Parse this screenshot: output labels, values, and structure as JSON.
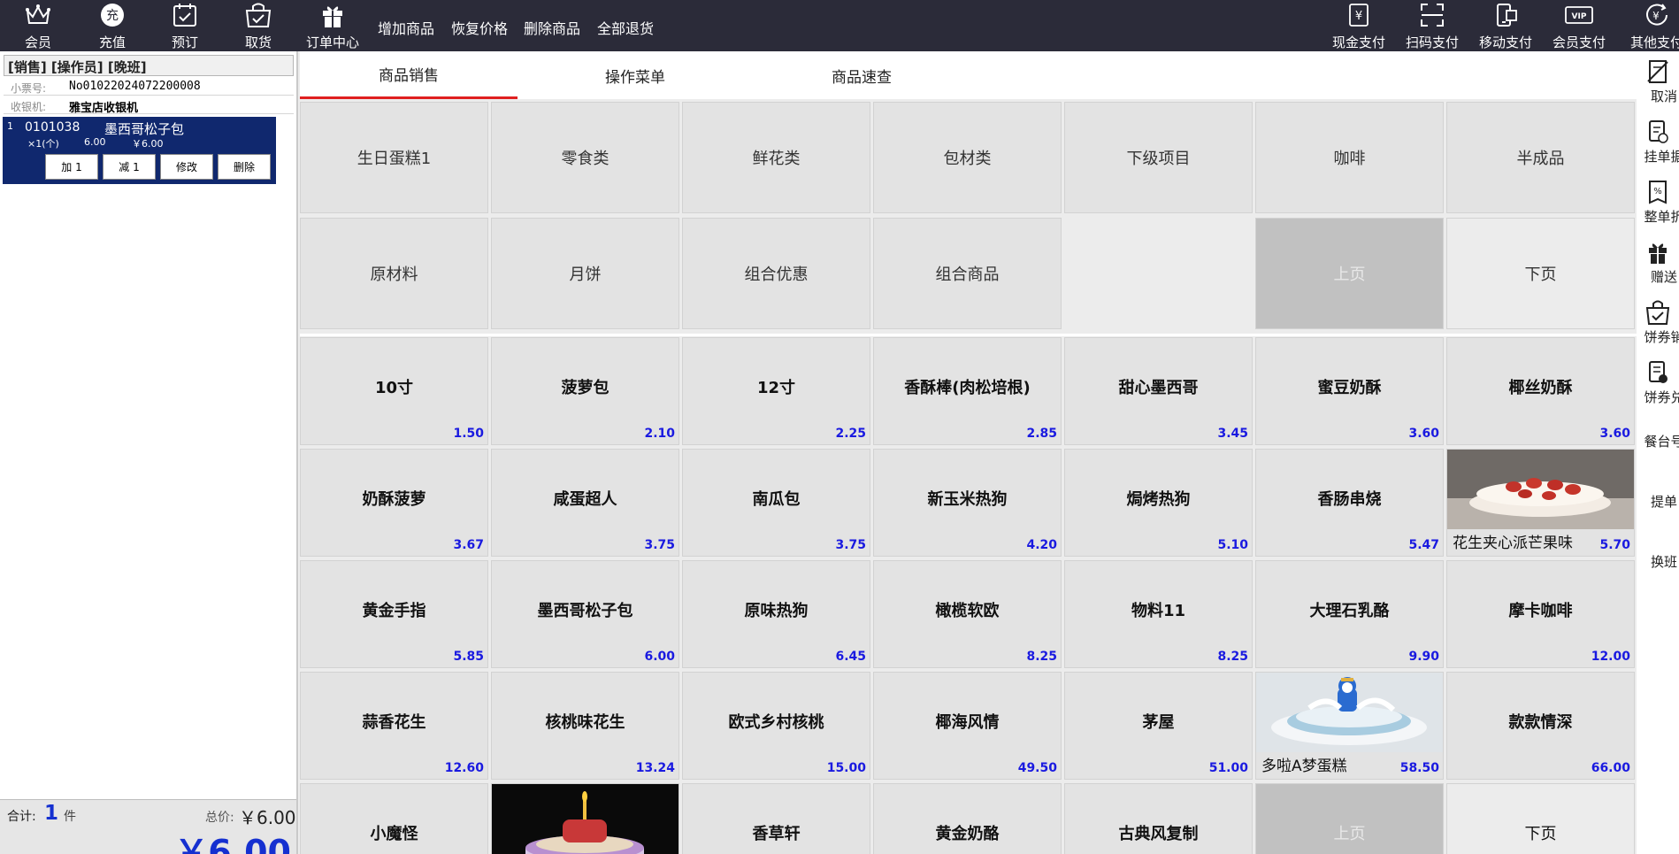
{
  "toolbar": {
    "left_buttons": [
      {
        "label": "会员",
        "icon": "crown-icon"
      },
      {
        "label": "充值",
        "icon": "recharge-icon"
      },
      {
        "label": "预订",
        "icon": "calendar-icon"
      },
      {
        "label": "取货",
        "icon": "pickup-icon"
      },
      {
        "label": "订单中心",
        "icon": "gift-icon"
      }
    ],
    "text_buttons": [
      "增加商品",
      "恢复价格",
      "删除商品",
      "全部退货"
    ],
    "payment_buttons": [
      {
        "label": "现金支付",
        "icon": "cash-icon",
        "glyph": "¥"
      },
      {
        "label": "扫码支付",
        "icon": "scan-icon",
        "glyph": "⌗"
      },
      {
        "label": "移动支付",
        "icon": "mobile-icon",
        "glyph": "▯"
      },
      {
        "label": "会员支付",
        "icon": "vip-icon",
        "glyph": "VIP"
      },
      {
        "label": "其他支付",
        "icon": "other-pay-icon",
        "glyph": "¥"
      }
    ]
  },
  "left": {
    "mode": "[销售] [操作员] [晚班]",
    "ticket_label": "小票号:",
    "ticket_no": "No01022024072200008",
    "cashier_label": "收银机:",
    "cashier": "雅宝店收银机",
    "item": {
      "index": "1",
      "code": "0101038",
      "name": "墨西哥松子包",
      "qty": "×1(个)",
      "price": "6.00",
      "subtotal": "￥6.00",
      "buttons": [
        "加 1",
        "减 1",
        "修改",
        "删除"
      ]
    },
    "footer": {
      "count_label": "合计:",
      "count": "1",
      "count_unit": "件",
      "total_label": "总价:",
      "total": "￥6.00",
      "big_total": "￥6.00"
    }
  },
  "tabs": [
    "商品销售",
    "操作菜单",
    "商品速查"
  ],
  "categories": [
    "生日蛋糕1",
    "零食类",
    "鲜花类",
    "包材类",
    "下级项目",
    "咖啡",
    "半成品",
    "原材料",
    "月饼",
    "组合优惠",
    "组合商品",
    "",
    "上页",
    "下页"
  ],
  "products": [
    {
      "name": "10寸",
      "price": "1.50"
    },
    {
      "name": "菠萝包",
      "price": "2.10"
    },
    {
      "name": "12寸",
      "price": "2.25"
    },
    {
      "name": "香酥棒(肉松培根)",
      "price": "2.85"
    },
    {
      "name": "甜心墨西哥",
      "price": "3.45"
    },
    {
      "name": "蜜豆奶酥",
      "price": "3.60"
    },
    {
      "name": "椰丝奶酥",
      "price": "3.60"
    },
    {
      "name": "奶酥菠萝",
      "price": "3.67"
    },
    {
      "name": "咸蛋超人",
      "price": "3.75"
    },
    {
      "name": "南瓜包",
      "price": "3.75"
    },
    {
      "name": "新玉米热狗",
      "price": "4.20"
    },
    {
      "name": "焗烤热狗",
      "price": "5.10"
    },
    {
      "name": "香肠串烧",
      "price": "5.47"
    },
    {
      "name": "花生夹心派芒果味",
      "price": "5.70",
      "image": "strawberry-pie"
    },
    {
      "name": "黄金手指",
      "price": "5.85"
    },
    {
      "name": "墨西哥松子包",
      "price": "6.00"
    },
    {
      "name": "原味热狗",
      "price": "6.45"
    },
    {
      "name": "橄榄软欧",
      "price": "8.25"
    },
    {
      "name": "物料11",
      "price": "8.25"
    },
    {
      "name": "大理石乳酪",
      "price": "9.90"
    },
    {
      "name": "摩卡咖啡",
      "price": "12.00"
    },
    {
      "name": "蒜香花生",
      "price": "12.60"
    },
    {
      "name": "核桃味花生",
      "price": "13.24"
    },
    {
      "name": "欧式乡村核桃",
      "price": "15.00"
    },
    {
      "name": "椰海风情",
      "price": "49.50"
    },
    {
      "name": "茅屋",
      "price": "51.00"
    },
    {
      "name": "多啦A梦蛋糕",
      "price": "58.50",
      "image": "doraemon-cake"
    },
    {
      "name": "款款情深",
      "price": "66.00"
    },
    {
      "name": "小魔怪",
      "price": ""
    },
    {
      "name": "",
      "price": "",
      "image": "birthday-cake"
    },
    {
      "name": "香草轩",
      "price": ""
    },
    {
      "name": "黄金奶酪",
      "price": ""
    },
    {
      "name": "古典风复制",
      "price": ""
    },
    {
      "name": "上页",
      "price": ""
    },
    {
      "name": "下页",
      "price": ""
    }
  ],
  "sidebar": [
    {
      "label": "取消",
      "icon": "cancel-icon"
    },
    {
      "label": "挂单据",
      "icon": "hold-order-icon"
    },
    {
      "label": "整单折",
      "icon": "discount-icon"
    },
    {
      "label": "赠送",
      "icon": "gift-icon"
    },
    {
      "label": "饼券销",
      "icon": "coupon-sell-icon"
    },
    {
      "label": "饼券兑",
      "icon": "coupon-redeem-icon"
    },
    {
      "label": "餐台号",
      "icon": ""
    },
    {
      "label": "提单",
      "icon": ""
    },
    {
      "label": "换班",
      "icon": ""
    }
  ],
  "colors": {
    "toolbar_bg": "#2b2b39",
    "selected_row": "#10286e",
    "price_blue": "#1a1ae0",
    "tab_underline": "#e02020"
  }
}
